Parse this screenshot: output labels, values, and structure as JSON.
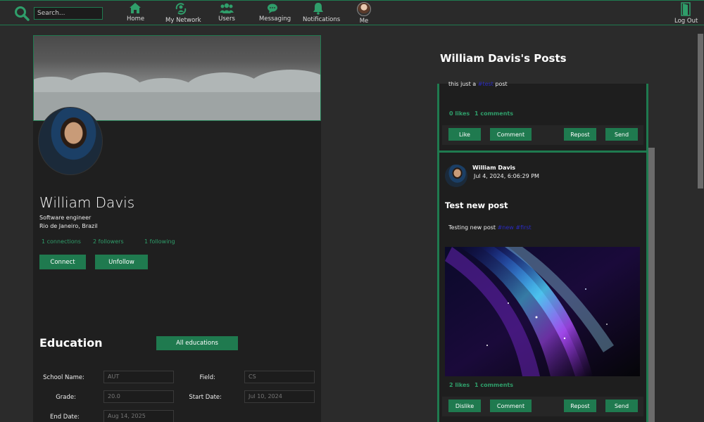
{
  "nav": {
    "search_placeholder": "Search...",
    "items": [
      {
        "label": "Home",
        "icon": "home-icon"
      },
      {
        "label": "My Network",
        "icon": "network-icon"
      },
      {
        "label": "Users",
        "icon": "users-icon"
      },
      {
        "label": "Messaging",
        "icon": "message-icon"
      },
      {
        "label": "Notifications",
        "icon": "bell-icon"
      },
      {
        "label": "Me",
        "icon": "avatar"
      }
    ],
    "logout_label": "Log Out"
  },
  "profile": {
    "name": "William Davis",
    "headline": "Software engineer",
    "location": "Rio de Janeiro, Brazil",
    "connections": "1 connections",
    "followers": "2 followers",
    "following": "1 following",
    "connect_label": "Connect",
    "unfollow_label": "Unfollow"
  },
  "education": {
    "title": "Education",
    "all_label": "All educations",
    "fields": {
      "school_label": "School Name:",
      "school_value": "AUT",
      "field_label": "Field:",
      "field_value": "CS",
      "grade_label": "Grade:",
      "grade_value": "20.0",
      "start_label": "Start Date:",
      "start_value": "Jul 10, 2024",
      "end_label": "End Date:",
      "end_value": "Aug 14, 2025"
    }
  },
  "posts": {
    "title": "William Davis's Posts",
    "post1": {
      "text_before": "this just a",
      "link": "#test",
      "text_after": "post",
      "likes": "0 likes",
      "comments": "1 comments",
      "actions": [
        "Like",
        "Comment",
        "Repost",
        "Send"
      ]
    },
    "post2": {
      "author": "William Davis",
      "date": "Jul 4, 2024, 6:06:29 PM",
      "heading": "Test new post",
      "text": "Testing new post",
      "link": "#new #first",
      "likes": "2 likes",
      "comments": "1 comments",
      "actions": [
        "Dislike",
        "Comment",
        "Repost",
        "Send"
      ]
    }
  },
  "colors": {
    "accent": "#1f7a4f",
    "accent_text": "#2f9e6a",
    "background": "#2b2b2b",
    "card": "#1f1f1f"
  }
}
